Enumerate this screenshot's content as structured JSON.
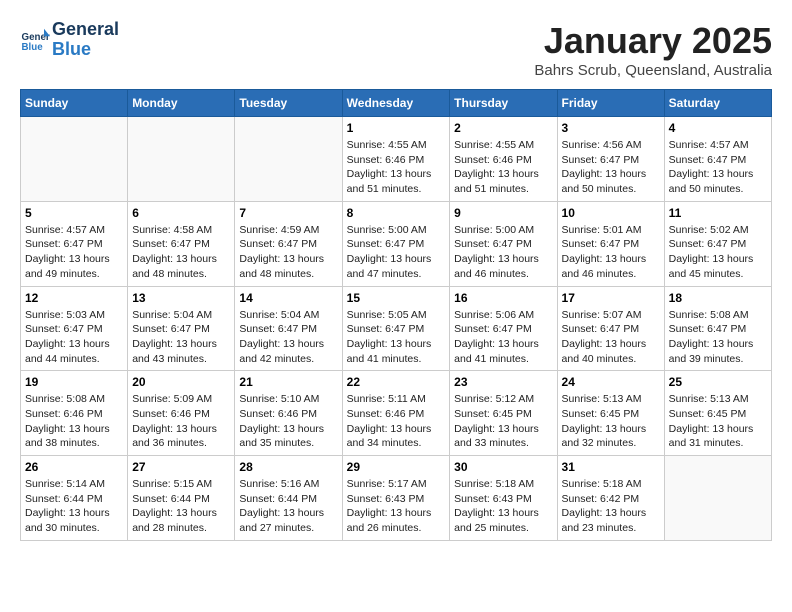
{
  "header": {
    "logo_line1": "General",
    "logo_line2": "Blue",
    "month": "January 2025",
    "location": "Bahrs Scrub, Queensland, Australia"
  },
  "weekdays": [
    "Sunday",
    "Monday",
    "Tuesday",
    "Wednesday",
    "Thursday",
    "Friday",
    "Saturday"
  ],
  "weeks": [
    [
      {
        "day": "",
        "info": ""
      },
      {
        "day": "",
        "info": ""
      },
      {
        "day": "",
        "info": ""
      },
      {
        "day": "1",
        "info": "Sunrise: 4:55 AM\nSunset: 6:46 PM\nDaylight: 13 hours\nand 51 minutes."
      },
      {
        "day": "2",
        "info": "Sunrise: 4:55 AM\nSunset: 6:46 PM\nDaylight: 13 hours\nand 51 minutes."
      },
      {
        "day": "3",
        "info": "Sunrise: 4:56 AM\nSunset: 6:47 PM\nDaylight: 13 hours\nand 50 minutes."
      },
      {
        "day": "4",
        "info": "Sunrise: 4:57 AM\nSunset: 6:47 PM\nDaylight: 13 hours\nand 50 minutes."
      }
    ],
    [
      {
        "day": "5",
        "info": "Sunrise: 4:57 AM\nSunset: 6:47 PM\nDaylight: 13 hours\nand 49 minutes."
      },
      {
        "day": "6",
        "info": "Sunrise: 4:58 AM\nSunset: 6:47 PM\nDaylight: 13 hours\nand 48 minutes."
      },
      {
        "day": "7",
        "info": "Sunrise: 4:59 AM\nSunset: 6:47 PM\nDaylight: 13 hours\nand 48 minutes."
      },
      {
        "day": "8",
        "info": "Sunrise: 5:00 AM\nSunset: 6:47 PM\nDaylight: 13 hours\nand 47 minutes."
      },
      {
        "day": "9",
        "info": "Sunrise: 5:00 AM\nSunset: 6:47 PM\nDaylight: 13 hours\nand 46 minutes."
      },
      {
        "day": "10",
        "info": "Sunrise: 5:01 AM\nSunset: 6:47 PM\nDaylight: 13 hours\nand 46 minutes."
      },
      {
        "day": "11",
        "info": "Sunrise: 5:02 AM\nSunset: 6:47 PM\nDaylight: 13 hours\nand 45 minutes."
      }
    ],
    [
      {
        "day": "12",
        "info": "Sunrise: 5:03 AM\nSunset: 6:47 PM\nDaylight: 13 hours\nand 44 minutes."
      },
      {
        "day": "13",
        "info": "Sunrise: 5:04 AM\nSunset: 6:47 PM\nDaylight: 13 hours\nand 43 minutes."
      },
      {
        "day": "14",
        "info": "Sunrise: 5:04 AM\nSunset: 6:47 PM\nDaylight: 13 hours\nand 42 minutes."
      },
      {
        "day": "15",
        "info": "Sunrise: 5:05 AM\nSunset: 6:47 PM\nDaylight: 13 hours\nand 41 minutes."
      },
      {
        "day": "16",
        "info": "Sunrise: 5:06 AM\nSunset: 6:47 PM\nDaylight: 13 hours\nand 41 minutes."
      },
      {
        "day": "17",
        "info": "Sunrise: 5:07 AM\nSunset: 6:47 PM\nDaylight: 13 hours\nand 40 minutes."
      },
      {
        "day": "18",
        "info": "Sunrise: 5:08 AM\nSunset: 6:47 PM\nDaylight: 13 hours\nand 39 minutes."
      }
    ],
    [
      {
        "day": "19",
        "info": "Sunrise: 5:08 AM\nSunset: 6:46 PM\nDaylight: 13 hours\nand 38 minutes."
      },
      {
        "day": "20",
        "info": "Sunrise: 5:09 AM\nSunset: 6:46 PM\nDaylight: 13 hours\nand 36 minutes."
      },
      {
        "day": "21",
        "info": "Sunrise: 5:10 AM\nSunset: 6:46 PM\nDaylight: 13 hours\nand 35 minutes."
      },
      {
        "day": "22",
        "info": "Sunrise: 5:11 AM\nSunset: 6:46 PM\nDaylight: 13 hours\nand 34 minutes."
      },
      {
        "day": "23",
        "info": "Sunrise: 5:12 AM\nSunset: 6:45 PM\nDaylight: 13 hours\nand 33 minutes."
      },
      {
        "day": "24",
        "info": "Sunrise: 5:13 AM\nSunset: 6:45 PM\nDaylight: 13 hours\nand 32 minutes."
      },
      {
        "day": "25",
        "info": "Sunrise: 5:13 AM\nSunset: 6:45 PM\nDaylight: 13 hours\nand 31 minutes."
      }
    ],
    [
      {
        "day": "26",
        "info": "Sunrise: 5:14 AM\nSunset: 6:44 PM\nDaylight: 13 hours\nand 30 minutes."
      },
      {
        "day": "27",
        "info": "Sunrise: 5:15 AM\nSunset: 6:44 PM\nDaylight: 13 hours\nand 28 minutes."
      },
      {
        "day": "28",
        "info": "Sunrise: 5:16 AM\nSunset: 6:44 PM\nDaylight: 13 hours\nand 27 minutes."
      },
      {
        "day": "29",
        "info": "Sunrise: 5:17 AM\nSunset: 6:43 PM\nDaylight: 13 hours\nand 26 minutes."
      },
      {
        "day": "30",
        "info": "Sunrise: 5:18 AM\nSunset: 6:43 PM\nDaylight: 13 hours\nand 25 minutes."
      },
      {
        "day": "31",
        "info": "Sunrise: 5:18 AM\nSunset: 6:42 PM\nDaylight: 13 hours\nand 23 minutes."
      },
      {
        "day": "",
        "info": ""
      }
    ]
  ]
}
